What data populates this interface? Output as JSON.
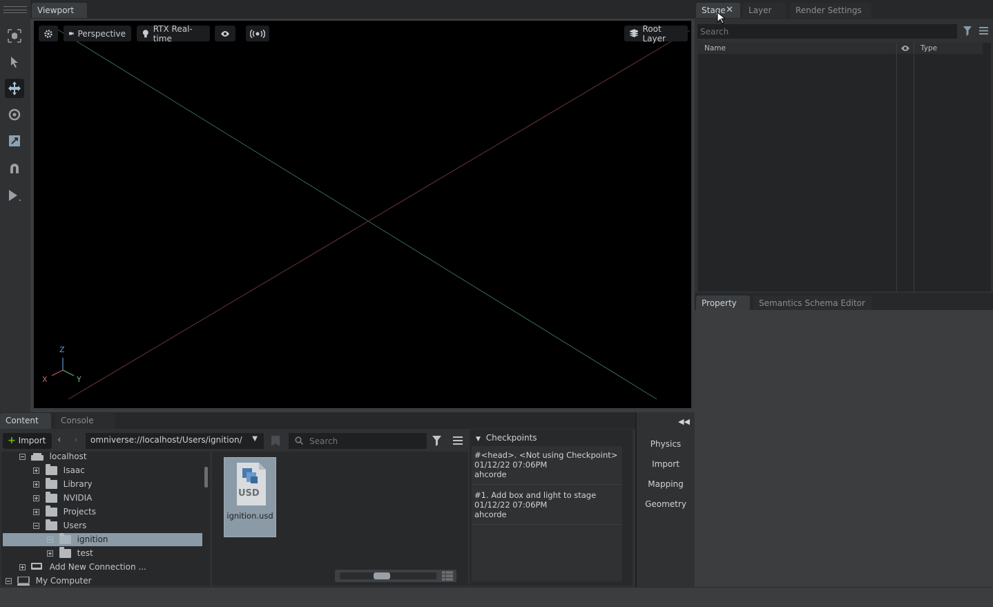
{
  "viewport": {
    "tab": "Viewport",
    "camera": "Perspective",
    "renderer": "RTX Real-time",
    "root_layer": "Root Layer",
    "axes": {
      "z": "Z",
      "x": "X",
      "y": "Y"
    }
  },
  "stage_panel": {
    "tabs": [
      "Stage",
      "Layer",
      "Render Settings"
    ],
    "search_placeholder": "Search",
    "columns": {
      "name": "Name",
      "type": "Type"
    }
  },
  "property_panel": {
    "tabs": [
      "Property",
      "Semantics Schema Editor"
    ]
  },
  "content": {
    "tabs": [
      "Content",
      "Console"
    ],
    "import_label": "Import",
    "path": "omniverse://localhost/Users/ignition/",
    "search_placeholder": "Search",
    "tree": [
      {
        "label": "localhost",
        "expanded": true
      },
      {
        "label": "Isaac"
      },
      {
        "label": "Library"
      },
      {
        "label": "NVIDIA"
      },
      {
        "label": "Projects"
      },
      {
        "label": "Users",
        "expanded": true
      },
      {
        "label": "ignition",
        "selected": true
      },
      {
        "label": "test"
      },
      {
        "label": "Add New Connection ..."
      },
      {
        "label": "My Computer"
      }
    ],
    "file": {
      "name": "ignition.usd",
      "badge": "USD"
    }
  },
  "checkpoints": {
    "header": "Checkpoints",
    "items": [
      {
        "line1": "#<head>.   <Not using Checkpoint>",
        "date": "01/12/22 07:06PM",
        "user": "ahcorde"
      },
      {
        "line1": "#1.   Add box and light to stage",
        "date": "01/12/22 07:06PM",
        "user": "ahcorde"
      }
    ]
  },
  "right_tools": [
    "Physics",
    "Import",
    "Mapping",
    "Geometry"
  ],
  "colors": {
    "accent_green": "#76b900",
    "selection": "#8a9aa6"
  }
}
